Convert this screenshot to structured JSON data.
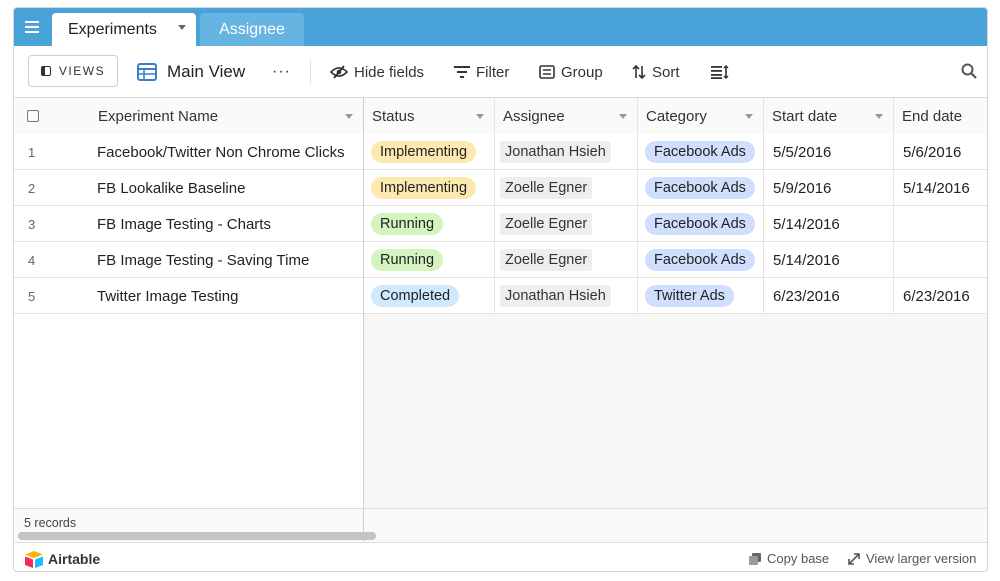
{
  "tabs": {
    "active": "Experiments",
    "inactive": "Assignee"
  },
  "toolbar": {
    "views": "VIEWS",
    "view_name": "Main View",
    "more": "···",
    "hide_fields": "Hide fields",
    "filter": "Filter",
    "group": "Group",
    "sort": "Sort"
  },
  "columns": {
    "name": "Experiment Name",
    "status": "Status",
    "assignee": "Assignee",
    "category": "Category",
    "start": "Start date",
    "end": "End date"
  },
  "rows": [
    {
      "num": "1",
      "name": "Facebook/Twitter Non Chrome Clicks",
      "status": "Implementing",
      "assignee": "Jonathan Hsieh",
      "category": "Facebook Ads",
      "start": "5/5/2016",
      "end": "5/6/2016"
    },
    {
      "num": "2",
      "name": "FB Lookalike Baseline",
      "status": "Implementing",
      "assignee": "Zoelle Egner",
      "category": "Facebook Ads",
      "start": "5/9/2016",
      "end": "5/14/2016"
    },
    {
      "num": "3",
      "name": "FB Image Testing - Charts",
      "status": "Running",
      "assignee": "Zoelle Egner",
      "category": "Facebook Ads",
      "start": "5/14/2016",
      "end": ""
    },
    {
      "num": "4",
      "name": "FB Image Testing - Saving Time",
      "status": "Running",
      "assignee": "Zoelle Egner",
      "category": "Facebook Ads",
      "start": "5/14/2016",
      "end": ""
    },
    {
      "num": "5",
      "name": "Twitter Image Testing",
      "status": "Completed",
      "assignee": "Jonathan Hsieh",
      "category": "Twitter Ads",
      "start": "6/23/2016",
      "end": "6/23/2016"
    }
  ],
  "status_colors": {
    "Implementing": "#fde8b0",
    "Running": "#d4f4bf",
    "Completed": "#cfeaff"
  },
  "summary": {
    "records": "5 records"
  },
  "footer": {
    "brand": "Airtable",
    "copy_base": "Copy base",
    "view_larger": "View larger version"
  },
  "colors": {
    "header": "#4aa3d8",
    "tab_inactive": "#66b4e1",
    "view_icon": "#3b82c4",
    "category": "#cfdffd"
  }
}
